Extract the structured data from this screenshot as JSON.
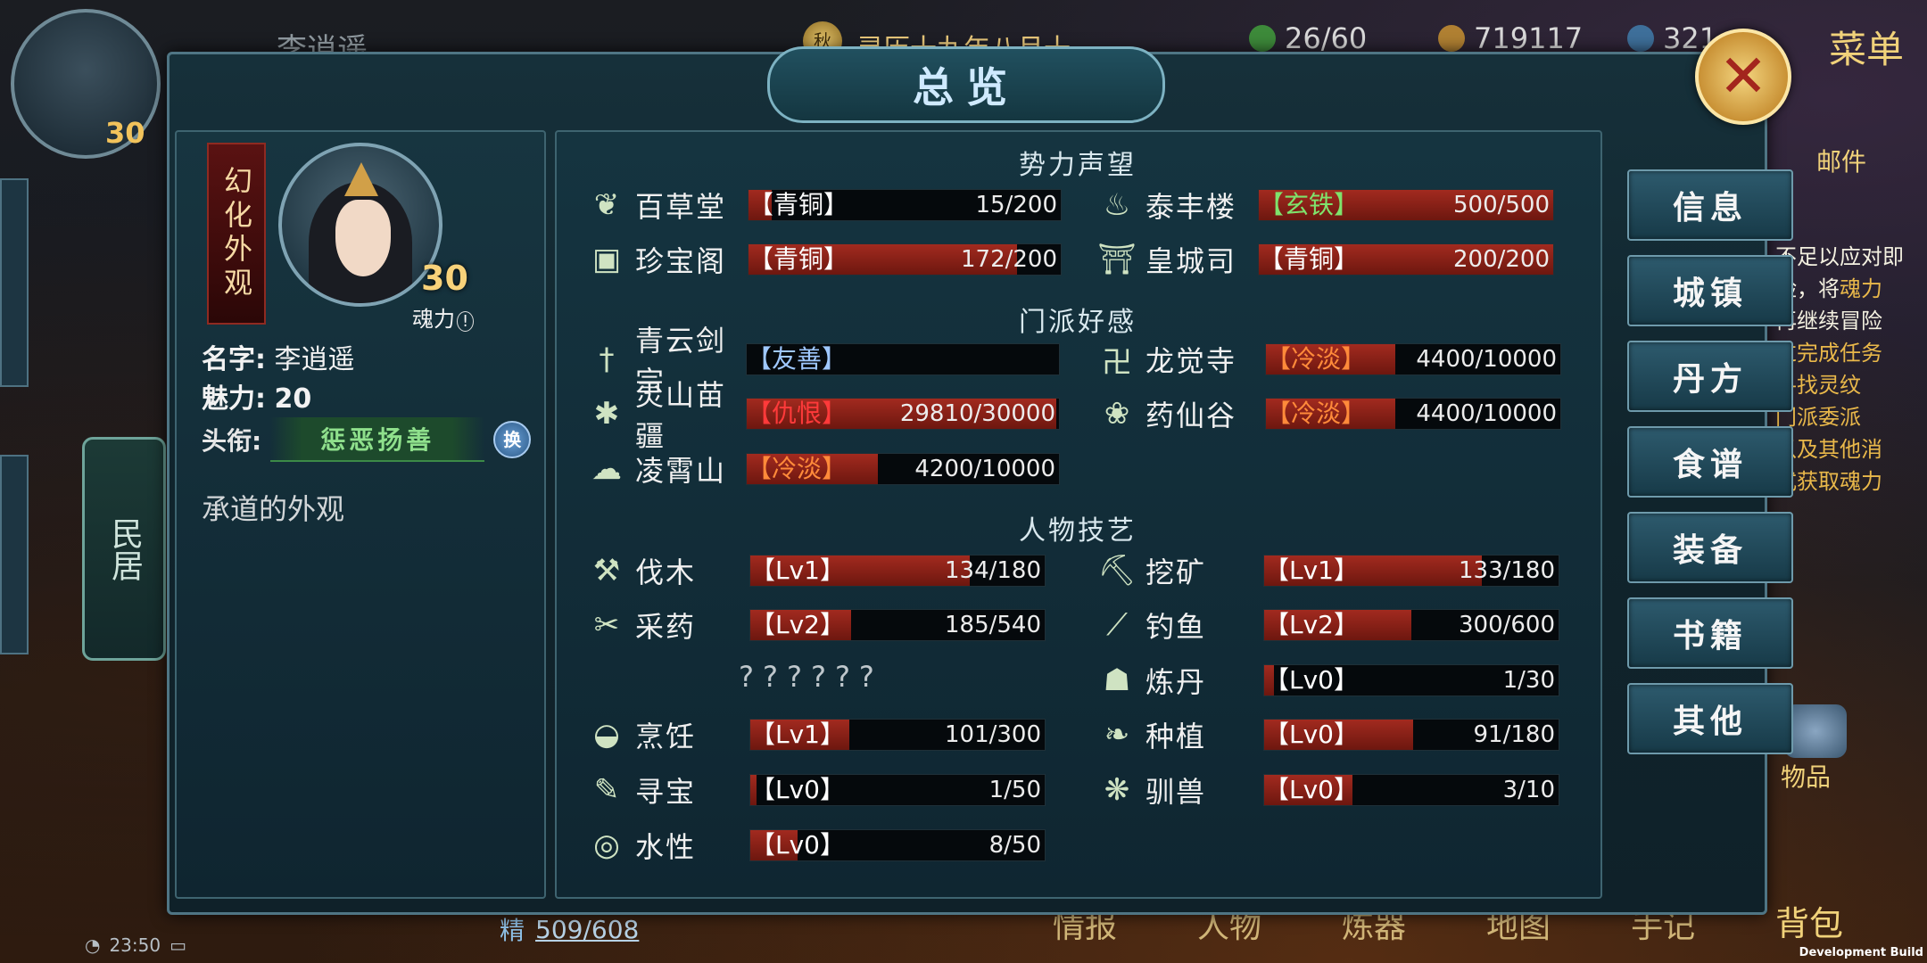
{
  "hud": {
    "player_name": "李逍遥",
    "player_level": "30",
    "date": "灵历十九年八月十一",
    "date_badge": "秋",
    "resources": [
      {
        "icon": "spiral-icon",
        "value": "26/60",
        "color": "#6fbf6a"
      },
      {
        "icon": "coin-icon",
        "value": "719117",
        "color": "#d8a548"
      },
      {
        "icon": "soul-icon",
        "value": "321",
        "color": "#6aa8d8"
      }
    ],
    "menu_label": "菜单",
    "mail_label": "邮件",
    "housing_label": "民居",
    "items_label": "物品",
    "bag_label": "背包",
    "stamina_label": "精",
    "stamina_value": "509/608",
    "bottom_tabs": [
      "情报",
      "人物",
      "炼器",
      "地图",
      "手记"
    ],
    "time": "23:50",
    "dev_build": "Development Build"
  },
  "quest_text": [
    {
      "text": "不足以应对即",
      "hl": false
    },
    {
      "text": "险，将",
      "hl": false,
      "tail": "魂力"
    },
    {
      "text": "再继续冒险",
      "hl": false
    },
    {
      "text": "过完成任务",
      "hl": true
    },
    {
      "text": "寻找灵纹",
      "hl": true
    },
    {
      "text": "门派委派",
      "hl": true
    },
    {
      "text": "以及其他消",
      "hl": true
    },
    {
      "text": "式获取魂力",
      "hl": true
    }
  ],
  "panel": {
    "title": "总览",
    "close_label": "✕"
  },
  "profile": {
    "appearance_label": "幻化外观",
    "soul_level": "30",
    "soul_label": "魂力",
    "name_key": "名字:",
    "name_value": "李逍遥",
    "charm_key": "魅力:",
    "charm_value": "20",
    "title_key": "头衔:",
    "title_value": "惩恶扬善",
    "swap_label": "换",
    "description": "承道的外观"
  },
  "sections": {
    "reputation": "势力声望",
    "sect_favor": "门派好感",
    "skills": "人物技艺",
    "unknown": "??????"
  },
  "reputation": [
    {
      "icon": "herb-leaf-icon",
      "name": "百草堂",
      "tier": "【青铜】",
      "tier_class": "t-bronze",
      "value": "15/200",
      "ratio": 0.075
    },
    {
      "icon": "steaming-pot-icon",
      "name": "泰丰楼",
      "tier": "【玄铁】",
      "tier_class": "t-iron",
      "value": "500/500",
      "ratio": 1.0
    },
    {
      "icon": "treasure-chest-icon",
      "name": "珍宝阁",
      "tier": "【青铜】",
      "tier_class": "t-bronze",
      "value": "172/200",
      "ratio": 0.86
    },
    {
      "icon": "palace-gate-icon",
      "name": "皇城司",
      "tier": "【青铜】",
      "tier_class": "t-bronze",
      "value": "200/200",
      "ratio": 1.0
    }
  ],
  "sects": [
    {
      "icon": "sword-icon",
      "name": "青云剑宗",
      "tier": "【友善】",
      "tier_class": "t-friendly",
      "value": "",
      "ratio": 0
    },
    {
      "icon": "buddha-icon",
      "name": "龙觉寺",
      "tier": "【冷淡】",
      "tier_class": "t-cold",
      "value": "4400/10000",
      "ratio": 0.44
    },
    {
      "icon": "butterfly-icon",
      "name": "灵山苗疆",
      "tier": "【仇恨】",
      "tier_class": "t-hatred",
      "value": "29810/30000",
      "ratio": 0.99
    },
    {
      "icon": "lotus-icon",
      "name": "药仙谷",
      "tier": "【冷淡】",
      "tier_class": "t-cold",
      "value": "4400/10000",
      "ratio": 0.44
    },
    {
      "icon": "cloud-dragon-icon",
      "name": "凌霄山",
      "tier": "【冷淡】",
      "tier_class": "t-cold",
      "value": "4200/10000",
      "ratio": 0.42
    }
  ],
  "skills": [
    {
      "icon": "axe-icon",
      "name": "伐木",
      "tier": "【Lv1】",
      "value": "134/180",
      "ratio": 0.744
    },
    {
      "icon": "pickaxe-icon",
      "name": "挖矿",
      "tier": "【Lv1】",
      "value": "133/180",
      "ratio": 0.739
    },
    {
      "icon": "herb-sickle-icon",
      "name": "采药",
      "tier": "【Lv2】",
      "value": "185/540",
      "ratio": 0.343
    },
    {
      "icon": "fishing-rod-icon",
      "name": "钓鱼",
      "tier": "【Lv2】",
      "value": "300/600",
      "ratio": 0.5
    },
    {
      "icon": "cauldron-icon",
      "name": "炼丹",
      "tier": "【Lv0】",
      "value": "1/30",
      "ratio": 0.033
    },
    {
      "icon": "cooking-pot-icon",
      "name": "烹饪",
      "tier": "【Lv1】",
      "value": "101/300",
      "ratio": 0.337
    },
    {
      "icon": "sprout-icon",
      "name": "种植",
      "tier": "【Lv0】",
      "value": "91/180",
      "ratio": 0.506
    },
    {
      "icon": "scroll-icon",
      "name": "寻宝",
      "tier": "【Lv0】",
      "value": "1/50",
      "ratio": 0.02
    },
    {
      "icon": "paw-icon",
      "name": "驯兽",
      "tier": "【Lv0】",
      "value": "3/10",
      "ratio": 0.3
    },
    {
      "icon": "water-swirl-icon",
      "name": "水性",
      "tier": "【Lv0】",
      "value": "8/50",
      "ratio": 0.16
    }
  ],
  "side_menu": [
    "信息",
    "城镇",
    "丹方",
    "食谱",
    "装备",
    "书籍",
    "其他"
  ]
}
